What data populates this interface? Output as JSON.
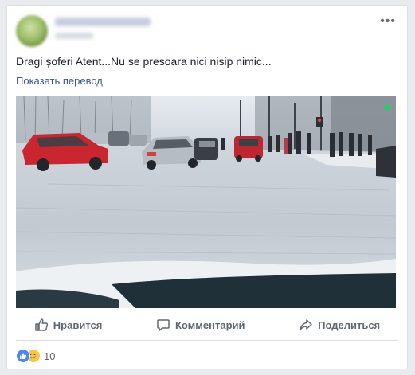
{
  "post": {
    "text": "Dragi șoferi Atent...Nu se presoara nici nisip nimic...",
    "translate_link": "Показать перевод",
    "more_icon": "•••"
  },
  "actions": {
    "like_label": "Нравится",
    "comment_label": "Комментарий",
    "share_label": "Поделиться"
  },
  "reactions": {
    "count": "10",
    "types": [
      "like",
      "sad"
    ]
  },
  "colors": {
    "link": "#385898",
    "text": "#1d2129",
    "muted": "#606770",
    "like_blue": "#4a86f5",
    "sad_yellow": "#f7c547"
  }
}
